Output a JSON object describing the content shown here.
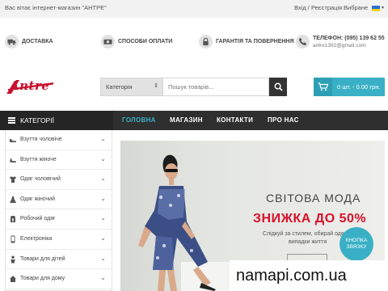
{
  "topbar": {
    "welcome": "Вас вітає інтернет-магазин \"АНТРЕ\"",
    "auth": "Вхід / Реєстрація",
    "wishlist": "Вибране"
  },
  "features": {
    "delivery": {
      "label": "ДОСТАВКА",
      "icon": "truck-icon"
    },
    "payment": {
      "label": "СПОСОБИ ОПЛАТИ",
      "icon": "money-icon"
    },
    "warranty": {
      "label": "ГАРАНТІЯ ТА ПОВЕРНЕННЯ",
      "icon": "lock-icon"
    },
    "contact": {
      "phone": "ТЕЛЕФОН: (095) 139 62 55",
      "email": "antre1392@gmail.com",
      "icon": "phone-icon"
    }
  },
  "logo": {
    "text": "Antre",
    "color": "#c8102e"
  },
  "search": {
    "category_label": "Категорія",
    "placeholder": "Пошук товарів..."
  },
  "cart": {
    "summary": "0 шт. - 0.00 грн.",
    "accent": "#3ab0c6"
  },
  "nav": {
    "categories_label": "КАТЕГОРІЇ",
    "links": [
      "ГОЛОВНА",
      "МАГАЗИН",
      "КОНТАКТИ",
      "ПРО НАС"
    ],
    "active": "ГОЛОВНА"
  },
  "sidebar": {
    "items": [
      {
        "label": "Взуття чоловіче",
        "icon": "mens-shoe-icon"
      },
      {
        "label": "Взуття жіноче",
        "icon": "womens-shoe-icon"
      },
      {
        "label": "Одяг чоловічий",
        "icon": "shirt-icon"
      },
      {
        "label": "Одяг жіночий",
        "icon": "dress-icon"
      },
      {
        "label": "Робочий одяг",
        "icon": "workwear-icon"
      },
      {
        "label": "Електроніка",
        "icon": "phone-device-icon"
      },
      {
        "label": "Товари для дітей",
        "icon": "child-icon"
      },
      {
        "label": "Товари для дому",
        "icon": "home-icon"
      }
    ]
  },
  "banner": {
    "title": "СВІТОВА МОДА",
    "sale": "ЗНИЖКА ДО 50%",
    "subtitle_line1": "Слідкуй за стилем, обирай одяг на",
    "subtitle_line2": "випадки життя",
    "badge_line1": "КНОПКА",
    "badge_line2": "ЗВЯЗКУ",
    "sale_color": "#d9102a"
  },
  "watermark": "namapi.com.ua"
}
